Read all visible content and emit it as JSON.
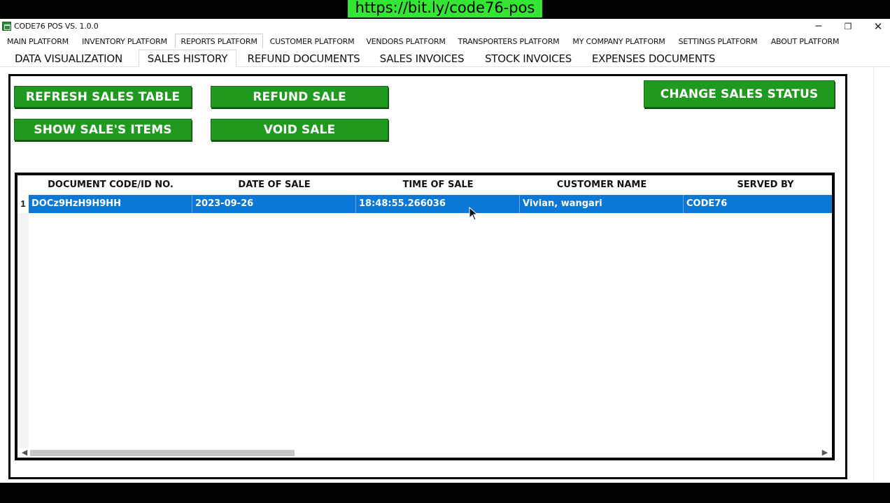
{
  "window": {
    "title": "CODE76 POS VS. 1.0.0",
    "banner_url": "https://bit.ly/code76-pos",
    "controls": {
      "minimize": "─",
      "restore": "❐",
      "close": "✕"
    }
  },
  "platform_tabs": [
    {
      "label": "MAIN PLATFORM"
    },
    {
      "label": "INVENTORY PLATFORM"
    },
    {
      "label": "REPORTS PLATFORM"
    },
    {
      "label": "CUSTOMER PLATFORM"
    },
    {
      "label": "VENDORS PLATFORM"
    },
    {
      "label": "TRANSPORTERS PLATFORM"
    },
    {
      "label": "MY COMPANY PLATFORM"
    },
    {
      "label": "SETTINGS PLATFORM"
    },
    {
      "label": "ABOUT PLATFORM"
    }
  ],
  "active_platform_tab": "REPORTS PLATFORM",
  "report_tabs": [
    {
      "label": "DATA VISUALIZATION"
    },
    {
      "label": "SALES HISTORY"
    },
    {
      "label": "REFUND DOCUMENTS"
    },
    {
      "label": "SALES INVOICES"
    },
    {
      "label": "STOCK INVOICES"
    },
    {
      "label": "EXPENSES DOCUMENTS"
    }
  ],
  "active_report_tab": "SALES HISTORY",
  "actions": {
    "refresh": "REFRESH SALES TABLE",
    "show_items": "SHOW SALE'S ITEMS",
    "refund": "REFUND SALE",
    "void": "VOID SALE",
    "change_status": "CHANGE SALES STATUS"
  },
  "table": {
    "columns": [
      "DOCUMENT CODE/ID NO.",
      "DATE OF SALE",
      "TIME OF SALE",
      "CUSTOMER NAME",
      "SERVED BY"
    ],
    "rows": [
      {
        "index": "1",
        "cells": [
          "DOCz9HzH9H9HH",
          "2023-09-26",
          "18:48:55.266036",
          "Vivian, wangari",
          "CODE76"
        ]
      }
    ],
    "scroll": {
      "left": "◀",
      "right": "▶"
    }
  },
  "colors": {
    "button_green": "#1f9a1f",
    "selected_row_blue": "#0b78d7",
    "banner_green": "#34e534"
  }
}
